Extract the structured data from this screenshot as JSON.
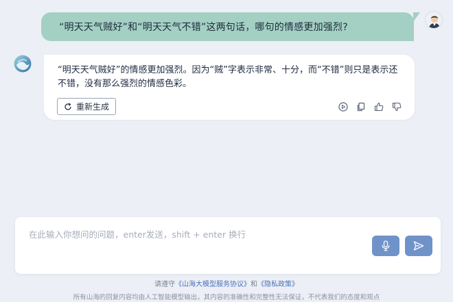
{
  "conversation": {
    "user_message": "“明天天气贼好”和“明天天气不错”这两句话，哪句的情感更加强烈?",
    "assistant_message": "“明天天气贼好”的情感更加强烈。因为“贼”字表示非常、十分，而“不错”则只是表示还不错，没有那么强烈的情感色彩。",
    "regenerate_label": "重新生成"
  },
  "actions": {
    "icons": [
      "play-icon",
      "copy-icon",
      "thumbs-up-icon",
      "thumbs-down-icon"
    ]
  },
  "input": {
    "placeholder": "在此输入你想问的问题，enter发送，shift + enter 换行",
    "value": ""
  },
  "footer": {
    "prefix": "请遵守",
    "agreement_link": "《山海大模型服务协议》",
    "and": "和",
    "privacy_link": "《隐私政策》",
    "disclaimer": "所有山海的回复内容均由人工智能模型输出，其内容的准确性和完整性无法保证，不代表我们的态度和观点"
  },
  "colors": {
    "background": "#eceff6",
    "user_bubble": "#a3d0c3",
    "button_accent": "#6f93c9",
    "link": "#4b72b8"
  }
}
